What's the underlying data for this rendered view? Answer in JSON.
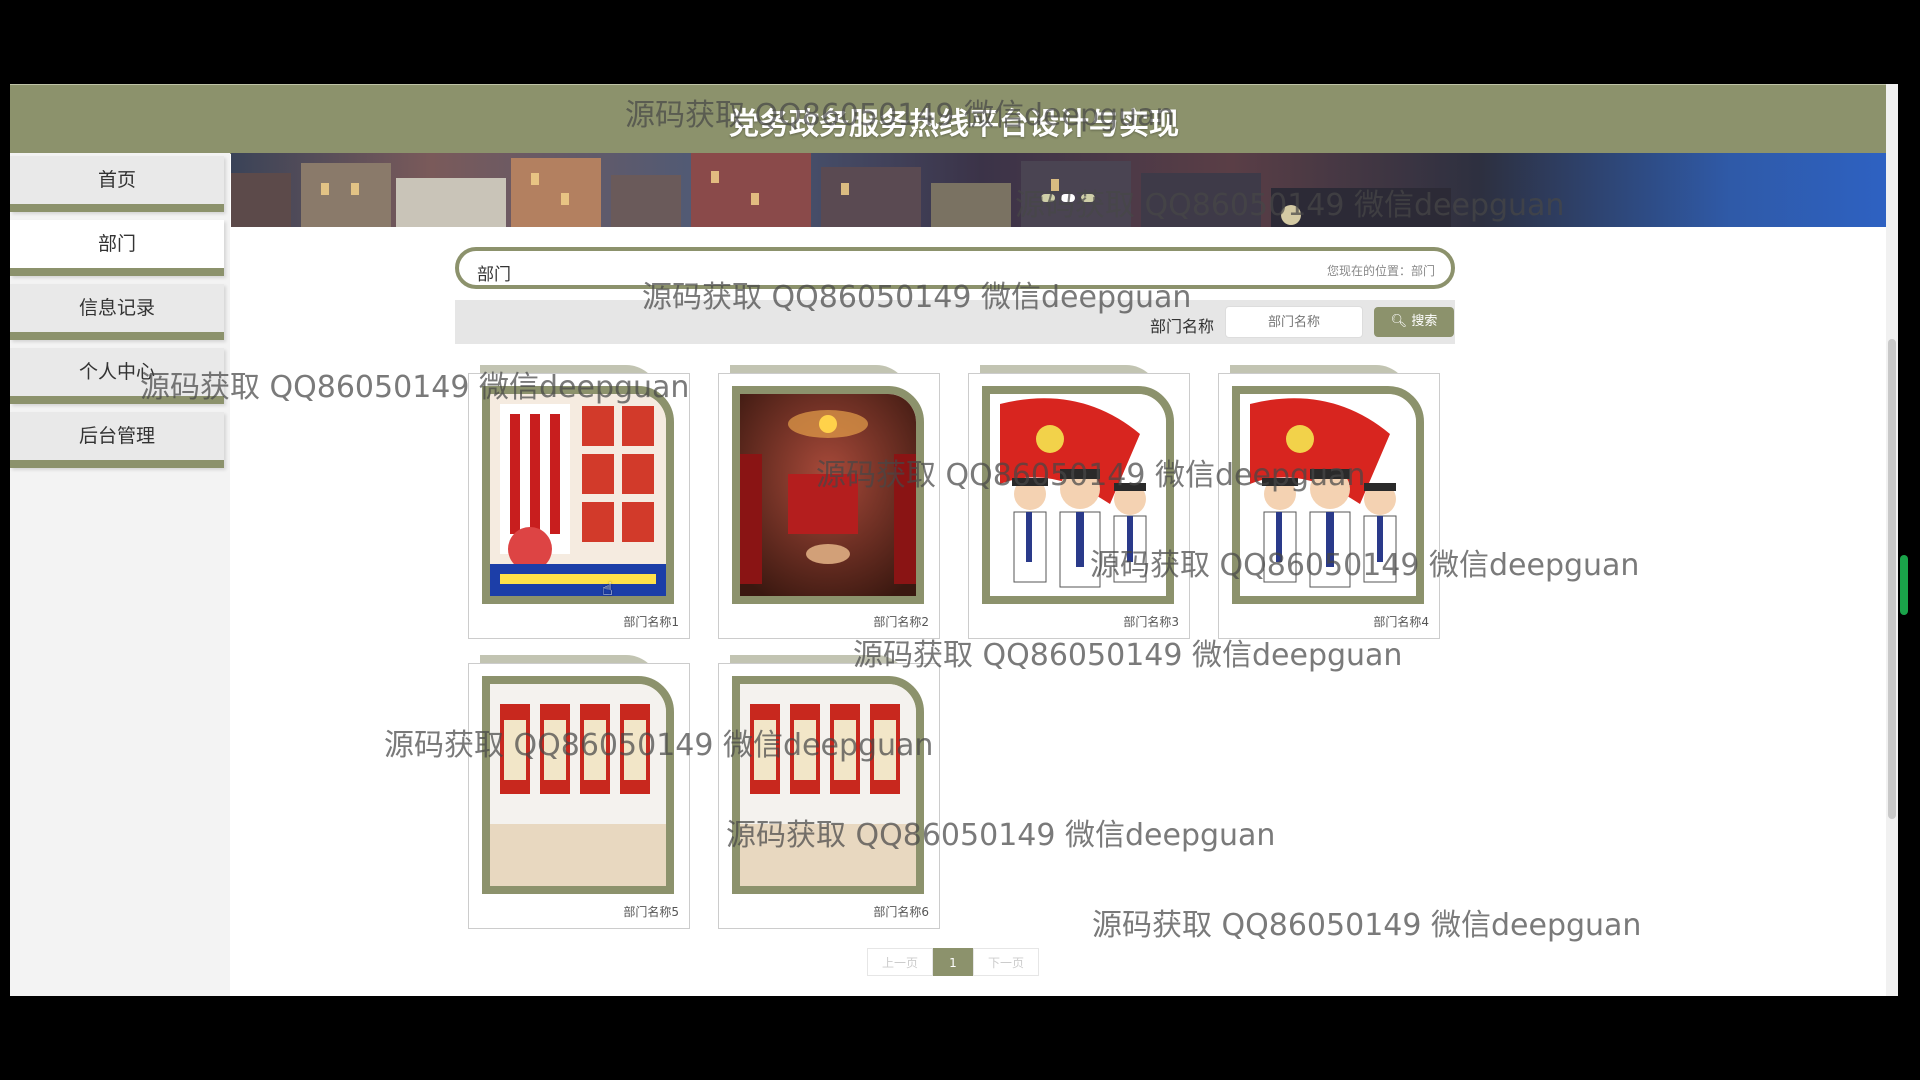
{
  "header": {
    "title": "党务政务服务热线平台设计与实现"
  },
  "sidebar": {
    "items": [
      {
        "label": "首页"
      },
      {
        "label": "部门"
      },
      {
        "label": "信息记录"
      },
      {
        "label": "个人中心"
      },
      {
        "label": "后台管理"
      }
    ],
    "active_index": 1
  },
  "breadcrumb": {
    "title": "部门",
    "position_text": "您现在的位置：部门"
  },
  "search": {
    "label": "部门名称",
    "placeholder": "部门名称",
    "button_label": "搜索"
  },
  "cards": [
    {
      "label": "部门名称1",
      "image": "poster-red-slogans"
    },
    {
      "label": "部门名称2",
      "image": "party-room-interior"
    },
    {
      "label": "部门名称3",
      "image": "cartoon-party-members"
    },
    {
      "label": "部门名称4",
      "image": "cartoon-party-members"
    },
    {
      "label": "部门名称5",
      "image": "wall-posters-room"
    },
    {
      "label": "部门名称6",
      "image": "wall-posters-room"
    }
  ],
  "pagination": {
    "prev_label": "上一页",
    "current": "1",
    "next_label": "下一页"
  },
  "watermark_text": "源码获取 QQ86050149 微信deepguan",
  "colors": {
    "accent": "#8c926c",
    "card_tab": "#c2c4b2",
    "background": "#ffffff"
  }
}
